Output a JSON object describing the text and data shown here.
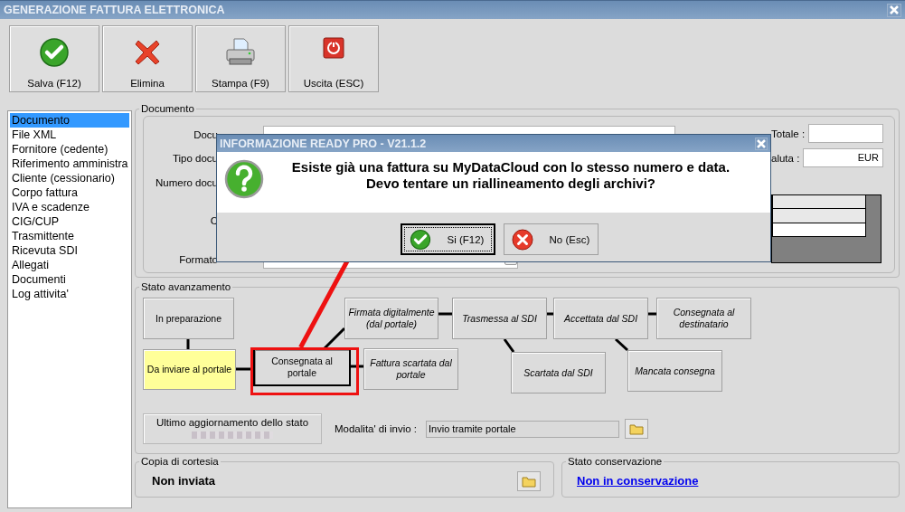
{
  "window": {
    "title": "GENERAZIONE FATTURA ELETTRONICA"
  },
  "toolbar": [
    {
      "kind": "save",
      "label": "Salva (F12)"
    },
    {
      "kind": "delete",
      "label": "Elimina"
    },
    {
      "kind": "print",
      "label": "Stampa (F9)"
    },
    {
      "kind": "exit",
      "label": "Uscita (ESC)"
    }
  ],
  "sidebar": {
    "items": [
      {
        "label": "Documento",
        "selected": true
      },
      {
        "label": "File XML",
        "selected": false
      },
      {
        "label": "Fornitore (cedente)",
        "selected": false
      },
      {
        "label": "Riferimento amministra",
        "selected": false
      },
      {
        "label": "Cliente (cessionario)",
        "selected": false
      },
      {
        "label": "Corpo fattura",
        "selected": false
      },
      {
        "label": "IVA e scadenze",
        "selected": false
      },
      {
        "label": "CIG/CUP",
        "selected": false
      },
      {
        "label": "Trasmittente",
        "selected": false
      },
      {
        "label": "Ricevuta SDI",
        "selected": false
      },
      {
        "label": "Allegati",
        "selected": false
      },
      {
        "label": "Documenti",
        "selected": false
      },
      {
        "label": "Log attivita'",
        "selected": false
      }
    ]
  },
  "documento": {
    "title": "Documento",
    "labels": [
      "Docu",
      "Tipo docu",
      "Numero docu",
      "C",
      "Formato"
    ],
    "totale_label": "Totale :",
    "valuta_label": "aluta :",
    "valuta": "EUR"
  },
  "stato_avanzamento": {
    "title": "Stato avanzamento",
    "nodes": [
      {
        "label": "In preparazione",
        "italic": false,
        "current": false,
        "selected": false
      },
      {
        "label": "Da inviare al portale",
        "italic": false,
        "current": true,
        "selected": false
      },
      {
        "label": "Consegnata al portale",
        "italic": false,
        "current": false,
        "selected": true
      },
      {
        "label": "Firmata digitalmente (dal portale)",
        "italic": true,
        "current": false,
        "selected": false
      },
      {
        "label": "Fattura scartata dal portale",
        "italic": true,
        "current": false,
        "selected": false
      },
      {
        "label": "Trasmessa al SDI",
        "italic": true,
        "current": false,
        "selected": false
      },
      {
        "label": "Accettata dal SDI",
        "italic": true,
        "current": false,
        "selected": false
      },
      {
        "label": "Consegnata al destinatario",
        "italic": true,
        "current": false,
        "selected": false
      },
      {
        "label": "Scartata dal SDI",
        "italic": true,
        "current": false,
        "selected": false
      },
      {
        "label": "Mancata consegna",
        "italic": true,
        "current": false,
        "selected": false
      }
    ],
    "ultimo_label": "Ultimo aggiornamento dello stato",
    "modalita_label": "Modalita' di invio :",
    "modalita_value": "Invio tramite portale"
  },
  "copia_cortesia": {
    "title": "Copia di cortesia",
    "value": "Non inviata"
  },
  "stato_conservazione": {
    "title": "Stato conservazione",
    "link": "Non in conservazione"
  },
  "dialog": {
    "title": "INFORMAZIONE READY PRO - V21.1.2",
    "message": [
      "Esiste già una fattura su MyDataCloud con lo stesso numero e data.",
      "Devo tentare un riallineamento degli archivi?"
    ],
    "buttons": [
      {
        "kind": "yes",
        "label": "Si (F12)",
        "selected": true
      },
      {
        "kind": "no",
        "label": "No (Esc)",
        "selected": false
      }
    ]
  }
}
